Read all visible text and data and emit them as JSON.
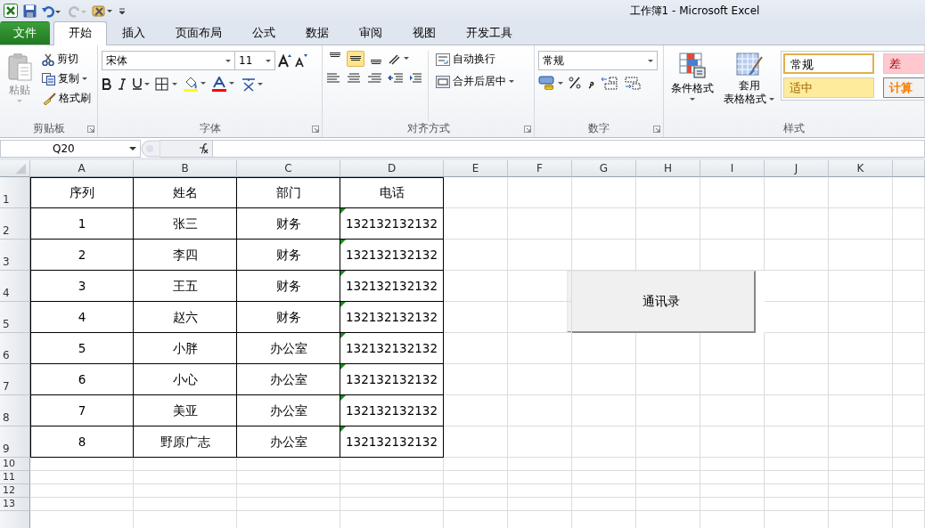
{
  "window": {
    "title": "工作簿1 - Microsoft Excel"
  },
  "tabs": [
    {
      "label": "文件",
      "kind": "file",
      "selected": false
    },
    {
      "label": "开始",
      "kind": "tab",
      "selected": true
    },
    {
      "label": "插入",
      "kind": "tab",
      "selected": false
    },
    {
      "label": "页面布局",
      "kind": "tab",
      "selected": false
    },
    {
      "label": "公式",
      "kind": "tab",
      "selected": false
    },
    {
      "label": "数据",
      "kind": "tab",
      "selected": false
    },
    {
      "label": "审阅",
      "kind": "tab",
      "selected": false
    },
    {
      "label": "视图",
      "kind": "tab",
      "selected": false
    },
    {
      "label": "开发工具",
      "kind": "tab",
      "selected": false
    }
  ],
  "ribbon": {
    "clipboard": {
      "paste": "粘贴",
      "cut": "剪切",
      "copy": "复制",
      "format_painter": "格式刷",
      "label": "剪贴板"
    },
    "font": {
      "name": "宋体",
      "size": "11",
      "label": "字体"
    },
    "alignment": {
      "vertical_align": [
        {
          "selected": false
        },
        {
          "selected": true
        },
        {
          "selected": false
        }
      ],
      "wrap_text": "自动换行",
      "merge_center": "合并后居中",
      "label": "对齐方式"
    },
    "number": {
      "format": "常规",
      "label": "数字"
    },
    "styles": {
      "conditional_formatting": "条件格式",
      "table_format": [
        "套用",
        "表格格式"
      ],
      "cell_styles": [
        {
          "label": "常规",
          "color": "#ffffff"
        },
        {
          "label": "差",
          "color": "#ffc7ce"
        },
        {
          "label": "适中",
          "color": "#ffeb9c"
        },
        {
          "label": "计算",
          "color": "#f2f2f2"
        }
      ],
      "label": "样式"
    }
  },
  "formula_bar": {
    "name_box": "Q20"
  },
  "sheet": {
    "columns": [
      "A",
      "B",
      "C",
      "D",
      "E",
      "F",
      "G",
      "H",
      "I",
      "J",
      "K"
    ],
    "rows": [
      {
        "header": "1",
        "cells": [
          "序列",
          "姓名",
          "部门",
          "电话"
        ],
        "flagged": false
      },
      {
        "header": "2",
        "cells": [
          "1",
          "张三",
          "财务",
          "132132132132"
        ],
        "flagged": true
      },
      {
        "header": "3",
        "cells": [
          "2",
          "李四",
          "财务",
          "132132132132"
        ],
        "flagged": true
      },
      {
        "header": "4",
        "cells": [
          "3",
          "王五",
          "财务",
          "132132132132"
        ],
        "flagged": true
      },
      {
        "header": "5",
        "cells": [
          "4",
          "赵六",
          "财务",
          "132132132132"
        ],
        "flagged": true
      },
      {
        "header": "6",
        "cells": [
          "5",
          "小胖",
          "办公室",
          "132132132132"
        ],
        "flagged": true
      },
      {
        "header": "7",
        "cells": [
          "6",
          "小心",
          "办公室",
          "132132132132"
        ],
        "flagged": true
      },
      {
        "header": "8",
        "cells": [
          "7",
          "美亚",
          "办公室",
          "132132132132"
        ],
        "flagged": true
      },
      {
        "header": "9",
        "cells": [
          "8",
          "野原广志",
          "办公室",
          "132132132132"
        ],
        "flagged": true
      }
    ],
    "empty_rows": [
      "10",
      "11",
      "12",
      "13"
    ]
  },
  "button": {
    "label": "通讯录"
  }
}
